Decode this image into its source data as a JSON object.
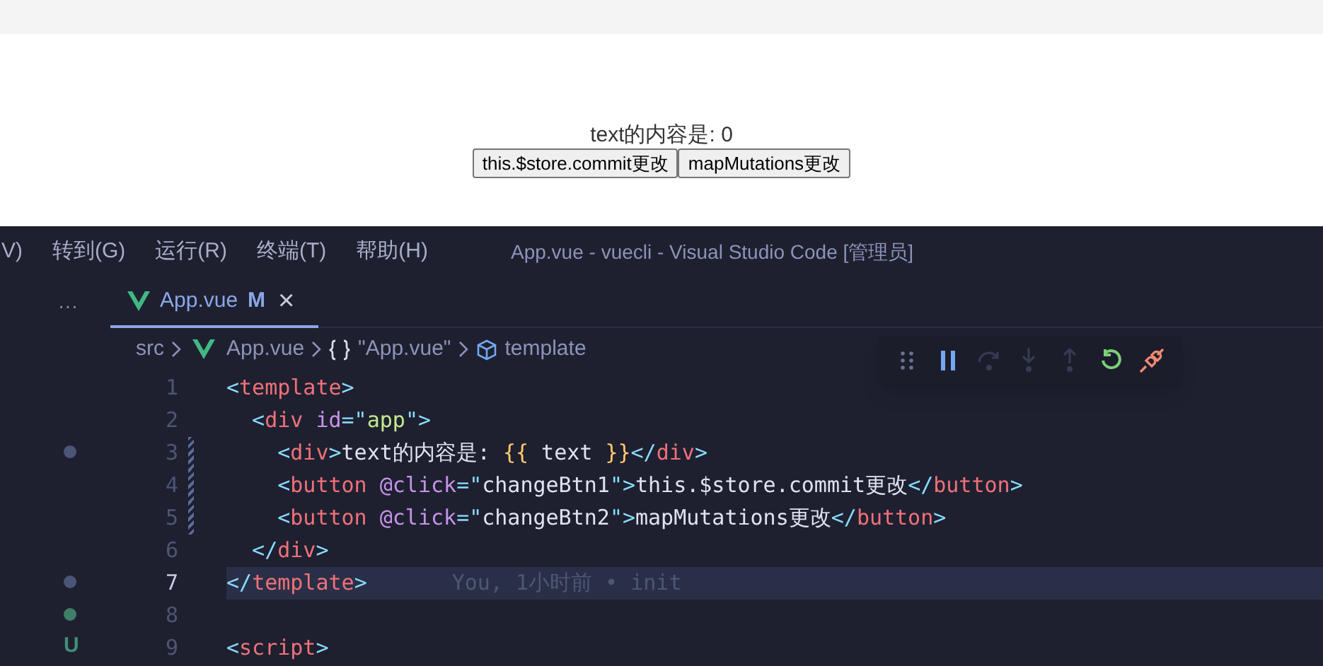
{
  "browser": {
    "output_text": "text的内容是: 0",
    "buttons": [
      "this.$store.commit更改",
      "mapMutations更改"
    ]
  },
  "menu": [
    "V)",
    "转到(G)",
    "运行(R)",
    "终端(T)",
    "帮助(H)"
  ],
  "window": {
    "title": "App.vue - vuecli - Visual Studio Code [管理员]"
  },
  "sidebar": {
    "more": "···"
  },
  "tabs": [
    {
      "label": "App.vue",
      "badge": "M",
      "close": "×",
      "selected": true
    }
  ],
  "breadcrumbs": [
    {
      "text": "src",
      "kind": "folder"
    },
    {
      "text": "App.vue",
      "kind": "vue"
    },
    {
      "text": "\"App.vue\"",
      "kind": "object"
    },
    {
      "text": "template",
      "kind": "element"
    }
  ],
  "debug_toolbar": [
    {
      "kind": "grip",
      "disabled": false
    },
    {
      "kind": "pause",
      "disabled": false
    },
    {
      "kind": "step-over",
      "disabled": true
    },
    {
      "kind": "step-into",
      "disabled": true
    },
    {
      "kind": "step-out",
      "disabled": true
    },
    {
      "kind": "restart",
      "disabled": false
    },
    {
      "kind": "disconnect",
      "disabled": false
    }
  ],
  "code_lines": [
    {
      "number": "1",
      "selected": false,
      "modified": false,
      "tokens": [
        {
          "text": "<",
          "kind": "punct"
        },
        {
          "text": "template",
          "kind": "tag"
        },
        {
          "text": ">",
          "kind": "punct"
        }
      ]
    },
    {
      "number": "2",
      "selected": false,
      "modified": false,
      "tokens": [
        {
          "text": "  <",
          "kind": "punct"
        },
        {
          "text": "div",
          "kind": "tag"
        },
        {
          "text": " id",
          "kind": "attr"
        },
        {
          "text": "=\"",
          "kind": "punct"
        },
        {
          "text": "app",
          "kind": "string"
        },
        {
          "text": "\">",
          "kind": "punct"
        }
      ]
    },
    {
      "number": "3",
      "selected": false,
      "modified": true,
      "marker": {
        "kind": "dot",
        "color": "#4b5578"
      },
      "tokens": [
        {
          "text": "    <",
          "kind": "punct"
        },
        {
          "text": "div",
          "kind": "tag"
        },
        {
          "text": ">",
          "kind": "punct"
        },
        {
          "text": "text的内容是: ",
          "kind": "text"
        },
        {
          "text": "{{",
          "kind": "mustache"
        },
        {
          "text": " text ",
          "kind": "text"
        },
        {
          "text": "}}",
          "kind": "mustache"
        },
        {
          "text": "</",
          "kind": "punct"
        },
        {
          "text": "div",
          "kind": "tag"
        },
        {
          "text": ">",
          "kind": "punct"
        }
      ]
    },
    {
      "number": "4",
      "selected": false,
      "modified": true,
      "tokens": [
        {
          "text": "    <",
          "kind": "punct"
        },
        {
          "text": "button",
          "kind": "tag"
        },
        {
          "text": " @click",
          "kind": "attr"
        },
        {
          "text": "=\"",
          "kind": "punct"
        },
        {
          "text": "changeBtn1",
          "kind": "text"
        },
        {
          "text": "\">",
          "kind": "punct"
        },
        {
          "text": "this.$store.commit更改",
          "kind": "text"
        },
        {
          "text": "</",
          "kind": "punct"
        },
        {
          "text": "button",
          "kind": "tag"
        },
        {
          "text": ">",
          "kind": "punct"
        }
      ]
    },
    {
      "number": "5",
      "selected": false,
      "modified": true,
      "tokens": [
        {
          "text": "    <",
          "kind": "punct"
        },
        {
          "text": "button",
          "kind": "tag"
        },
        {
          "text": " @click",
          "kind": "attr"
        },
        {
          "text": "=\"",
          "kind": "punct"
        },
        {
          "text": "changeBtn2",
          "kind": "text"
        },
        {
          "text": "\">",
          "kind": "punct"
        },
        {
          "text": "mapMutations更改",
          "kind": "text"
        },
        {
          "text": "</",
          "kind": "punct"
        },
        {
          "text": "button",
          "kind": "tag"
        },
        {
          "text": ">",
          "kind": "punct"
        }
      ]
    },
    {
      "number": "6",
      "selected": false,
      "modified": false,
      "tokens": [
        {
          "text": "  </",
          "kind": "punct"
        },
        {
          "text": "div",
          "kind": "tag"
        },
        {
          "text": ">",
          "kind": "punct"
        }
      ]
    },
    {
      "number": "7",
      "selected": true,
      "modified": false,
      "marker": {
        "kind": "dot",
        "color": "#4b5578"
      },
      "blame": "You, 1小时前 • init",
      "tokens": [
        {
          "text": "</",
          "kind": "punct"
        },
        {
          "text": "template",
          "kind": "tag"
        },
        {
          "text": ">",
          "kind": "punct"
        }
      ]
    },
    {
      "number": "8",
      "selected": false,
      "modified": false,
      "marker": {
        "kind": "dot",
        "color": "#3f7f6a"
      }
    },
    {
      "number": "9",
      "selected": false,
      "modified": false,
      "marker": {
        "kind": "letter",
        "text": "U",
        "color": "#3f8f78"
      },
      "tokens": [
        {
          "text": "<",
          "kind": "punct"
        },
        {
          "text": "script",
          "kind": "tag"
        },
        {
          "text": ">",
          "kind": "punct"
        }
      ]
    }
  ]
}
